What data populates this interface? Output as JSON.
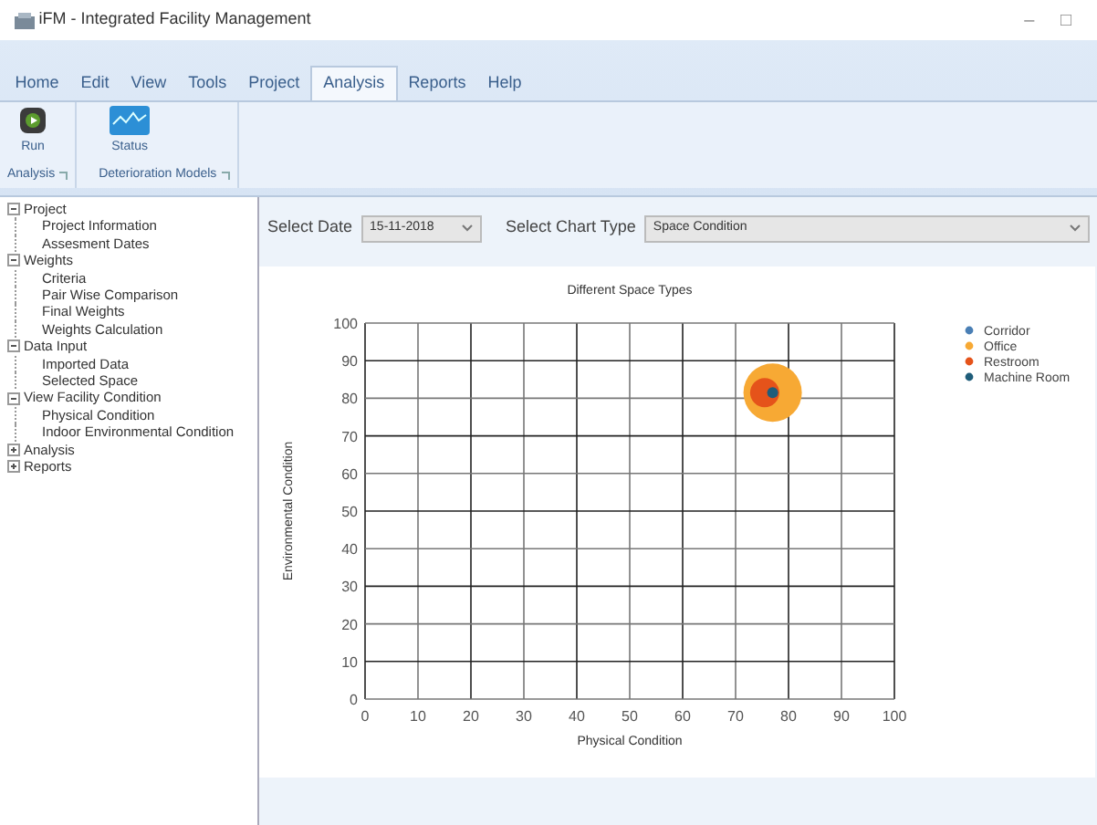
{
  "window": {
    "title": "iFM - Integrated Facility Management",
    "controls": [
      "–",
      "□"
    ]
  },
  "ribbon": {
    "tabs": [
      {
        "label": "Home",
        "selected": false
      },
      {
        "label": "Edit",
        "selected": false
      },
      {
        "label": "View",
        "selected": false
      },
      {
        "label": "Tools",
        "selected": false
      },
      {
        "label": "Project",
        "selected": false
      },
      {
        "label": "Analysis",
        "selected": true
      },
      {
        "label": "Reports",
        "selected": false
      },
      {
        "label": "Help",
        "selected": false
      }
    ],
    "groups": [
      {
        "label": "Analysis",
        "buttons": [
          {
            "label": "Run",
            "kind": "run"
          }
        ]
      },
      {
        "label": "Deterioration Models",
        "buttons": [
          {
            "label": "Status",
            "kind": "status"
          }
        ]
      }
    ]
  },
  "tree": [
    {
      "label": "Project",
      "expanded": true,
      "children": [
        {
          "label": "Project Information"
        },
        {
          "label": "Assesment Dates"
        }
      ]
    },
    {
      "label": "Weights",
      "expanded": true,
      "children": [
        {
          "label": "Criteria"
        },
        {
          "label": "Pair Wise Comparison"
        },
        {
          "label": "Final Weights"
        },
        {
          "label": "Weights Calculation"
        }
      ]
    },
    {
      "label": "Data Input",
      "expanded": true,
      "children": [
        {
          "label": "Imported Data"
        },
        {
          "label": "Selected Space"
        }
      ]
    },
    {
      "label": "View Facility Condition",
      "expanded": true,
      "children": [
        {
          "label": "Physical Condition"
        },
        {
          "label": "Indoor Environmental Condition"
        }
      ]
    },
    {
      "label": "Analysis",
      "expanded": false
    },
    {
      "label": "Reports",
      "expanded": false
    }
  ],
  "filters": [
    {
      "label": "Select Date",
      "value": "15-11-2018"
    },
    {
      "label": "Select Chart Type",
      "value": "Space Condition"
    }
  ],
  "chart": {
    "chart_data": {
      "type": "scatter",
      "title": "Different Space Types",
      "xlabel": "Physical Condition",
      "ylabel": "Environmental Condition",
      "xlim": [
        0,
        100
      ],
      "ylim": [
        0,
        100
      ],
      "xticks": [
        0,
        10,
        20,
        30,
        40,
        50,
        60,
        70,
        80,
        90,
        100
      ],
      "yticks": [
        0,
        10,
        20,
        30,
        40,
        50,
        60,
        70,
        80,
        90,
        100
      ],
      "grid": true,
      "legend": "right",
      "x": [
        75.5,
        77
      ],
      "series": [
        {
          "name": "Corridor",
          "color": "#4a7fb5",
          "values": [
            null,
            null
          ]
        },
        {
          "name": "Office",
          "color": "#f7a934",
          "values": [
            null,
            81.5
          ]
        },
        {
          "name": "Restroom",
          "color": "#e5531a",
          "values": [
            81.5,
            null
          ]
        },
        {
          "name": "Machine Room",
          "color": "#1f5d7a",
          "values": [
            null,
            81.5
          ]
        }
      ]
    }
  }
}
